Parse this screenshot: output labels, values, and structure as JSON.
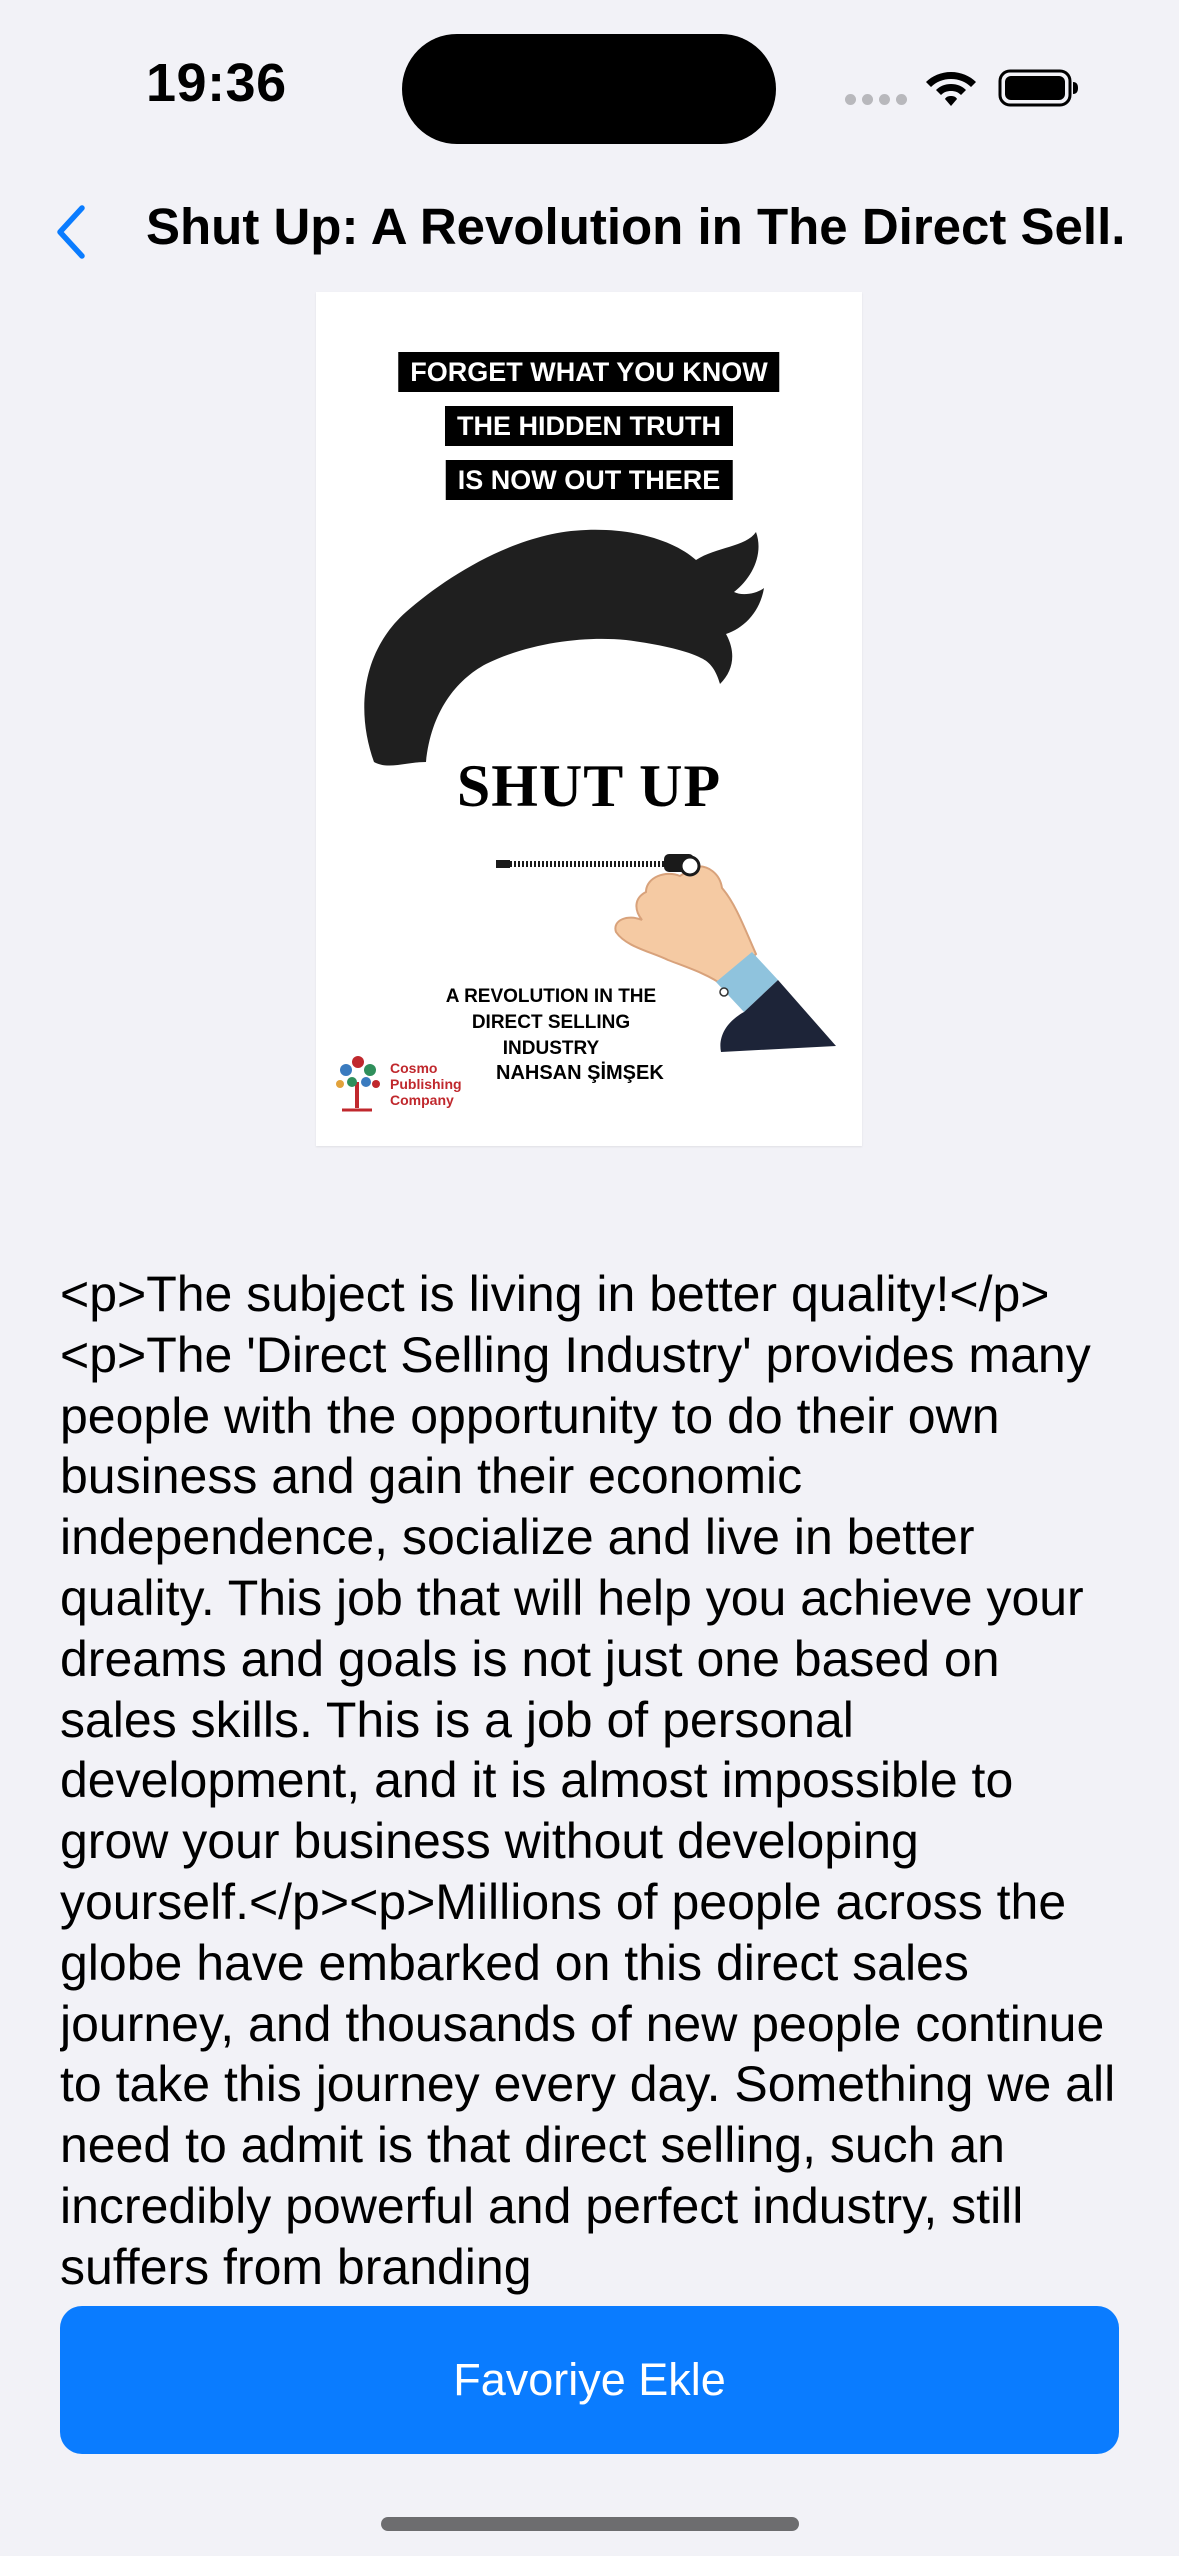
{
  "status_bar": {
    "time": "19:36"
  },
  "nav": {
    "back_icon": "chevron-left-icon",
    "title": "Shut Up: A Revolution in The Direct Sell..."
  },
  "cover": {
    "banner_lines": [
      "FORGET WHAT YOU KNOW",
      "THE HIDDEN TRUTH",
      "IS NOW OUT THERE"
    ],
    "title": "SHUT UP",
    "subtitle": "A REVOLUTION IN THE DIRECT SELLING INDUSTRY",
    "author": "NAHSAN ŞİMŞEK",
    "publisher": "Cosmo Publishing Company"
  },
  "description": "<p>The subject is living in better quality!</p><p>The 'Direct Selling Industry' provides many people with the opportunity to do their own business and gain their economic independence, socialize and live in better quality. This job that will help you achieve your dreams and goals is not just one based on sales skills. This is a job of personal development, and it is almost impossible to grow your business without developing yourself.</p><p>Millions of people across the globe have embarked on this direct sales journey, and thousands of new people continue to take this journey every day. Something we all need to admit is that direct selling, such an incredibly powerful and perfect industry, still suffers from branding",
  "actions": {
    "favorite_label": "Favoriye Ekle"
  },
  "colors": {
    "accent": "#0a7cff",
    "background": "#f2f2f7"
  }
}
